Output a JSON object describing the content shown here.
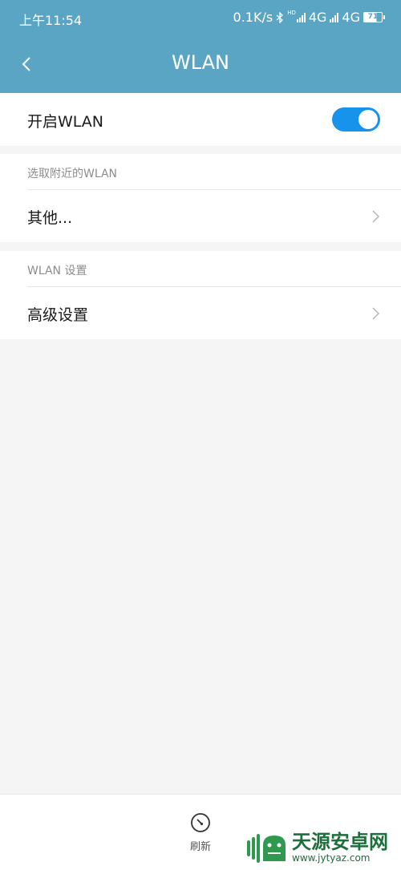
{
  "status_bar": {
    "time": "上午11:54",
    "speed": "0.1K/s",
    "network_1": "4G",
    "network_2": "4G",
    "hd_tag": "HD",
    "battery": "71",
    "bluetooth_icon": "bluetooth-icon",
    "signal_icon": "signal-bars-icon"
  },
  "header": {
    "title": "WLAN",
    "back_icon": "chevron-left-icon",
    "background_color": "#5aa5c4"
  },
  "wlan_toggle": {
    "label": "开启WLAN",
    "enabled": true,
    "accent_color": "#1893ec"
  },
  "nearby_section": {
    "header": "选取附近的WLAN",
    "other_label": "其他..."
  },
  "settings_section": {
    "header": "WLAN 设置",
    "advanced_label": "高级设置"
  },
  "bottom_bar": {
    "refresh_label": "刷新",
    "refresh_icon": "refresh-icon"
  },
  "watermark": {
    "title": "天源安卓网",
    "url": "www.jytyaz.com"
  }
}
